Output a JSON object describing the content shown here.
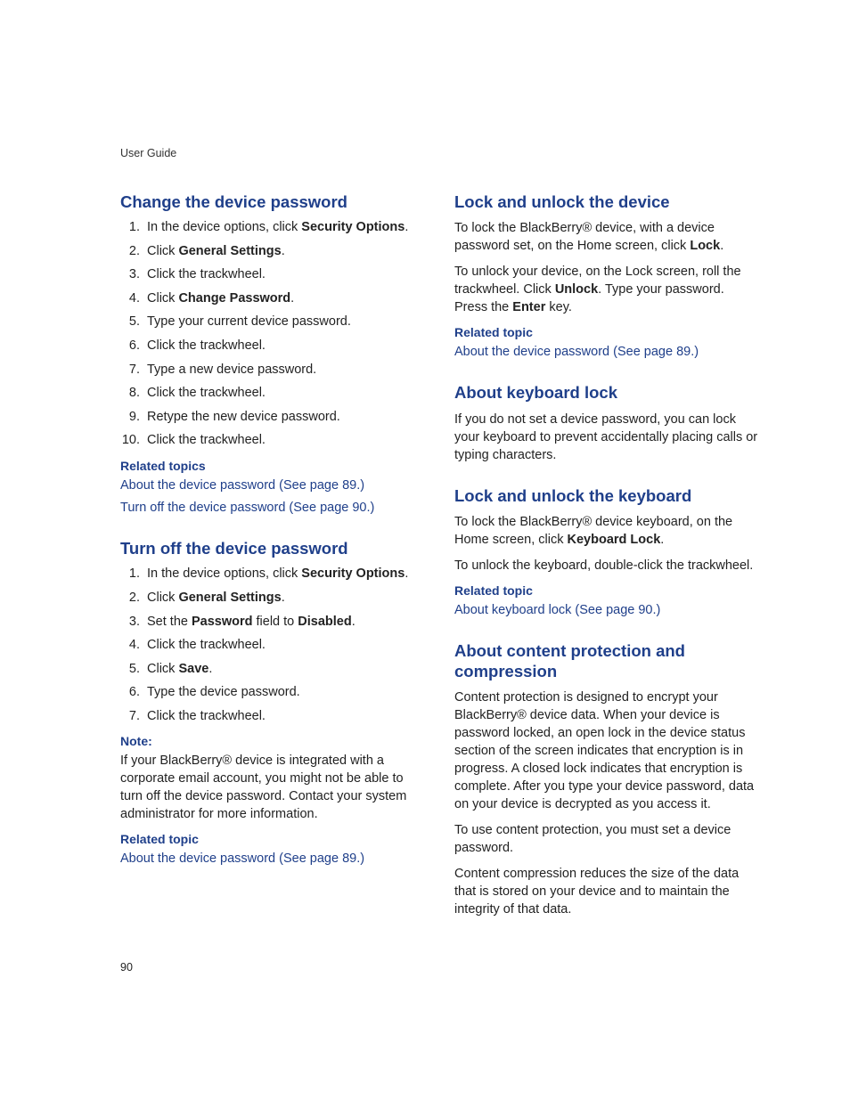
{
  "running_header": "User Guide",
  "page_number": "90",
  "left": {
    "s1": {
      "heading": "Change the device password",
      "steps": [
        [
          {
            "t": "In the device options, click "
          },
          {
            "t": "Security Options",
            "b": true
          },
          {
            "t": "."
          }
        ],
        [
          {
            "t": "Click "
          },
          {
            "t": "General Settings",
            "b": true
          },
          {
            "t": "."
          }
        ],
        [
          {
            "t": "Click the trackwheel."
          }
        ],
        [
          {
            "t": "Click "
          },
          {
            "t": "Change Password",
            "b": true
          },
          {
            "t": "."
          }
        ],
        [
          {
            "t": "Type your current device password."
          }
        ],
        [
          {
            "t": "Click the trackwheel."
          }
        ],
        [
          {
            "t": "Type a new device password."
          }
        ],
        [
          {
            "t": "Click the trackwheel."
          }
        ],
        [
          {
            "t": "Retype the new device password."
          }
        ],
        [
          {
            "t": "Click the trackwheel."
          }
        ]
      ],
      "related_heading": "Related topics",
      "related_links": [
        "About the device password (See page 89.)",
        "Turn off the device password (See page 90.)"
      ]
    },
    "s2": {
      "heading": "Turn off the device password",
      "steps": [
        [
          {
            "t": "In the device options, click "
          },
          {
            "t": "Security Options",
            "b": true
          },
          {
            "t": "."
          }
        ],
        [
          {
            "t": "Click "
          },
          {
            "t": "General Settings",
            "b": true
          },
          {
            "t": "."
          }
        ],
        [
          {
            "t": "Set the "
          },
          {
            "t": "Password",
            "b": true
          },
          {
            "t": " field to "
          },
          {
            "t": "Disabled",
            "b": true
          },
          {
            "t": "."
          }
        ],
        [
          {
            "t": "Click the trackwheel."
          }
        ],
        [
          {
            "t": "Click "
          },
          {
            "t": "Save",
            "b": true
          },
          {
            "t": "."
          }
        ],
        [
          {
            "t": "Type the device password."
          }
        ],
        [
          {
            "t": "Click the trackwheel."
          }
        ]
      ],
      "note_heading": "Note:",
      "note_body": "If your BlackBerry® device is integrated with a corporate email account, you might not be able to turn off the device password. Contact your system administrator for more information.",
      "related_heading": "Related topic",
      "related_links": [
        "About the device password (See page 89.)"
      ]
    }
  },
  "right": {
    "s1": {
      "heading": "Lock and unlock the device",
      "paras": [
        [
          {
            "t": "To lock the BlackBerry® device, with a device password set, on the Home screen, click "
          },
          {
            "t": "Lock",
            "b": true
          },
          {
            "t": "."
          }
        ],
        [
          {
            "t": "To unlock your device, on the Lock screen, roll the trackwheel. Click "
          },
          {
            "t": "Unlock",
            "b": true
          },
          {
            "t": ". Type your password. Press the "
          },
          {
            "t": "Enter",
            "b": true
          },
          {
            "t": " key."
          }
        ]
      ],
      "related_heading": "Related topic",
      "related_links": [
        "About the device password (See page 89.)"
      ]
    },
    "s2": {
      "heading": "About keyboard lock",
      "paras": [
        [
          {
            "t": "If you do not set a device password, you can lock your keyboard to prevent accidentally placing calls or typing characters."
          }
        ]
      ]
    },
    "s3": {
      "heading": "Lock and unlock the keyboard",
      "paras": [
        [
          {
            "t": "To lock the BlackBerry® device keyboard, on the Home screen, click "
          },
          {
            "t": "Keyboard Lock",
            "b": true
          },
          {
            "t": "."
          }
        ],
        [
          {
            "t": "To unlock the keyboard, double-click the trackwheel."
          }
        ]
      ],
      "related_heading": "Related topic",
      "related_links": [
        "About keyboard lock (See page 90.)"
      ]
    },
    "s4": {
      "heading": "About content protection and compression",
      "paras": [
        [
          {
            "t": "Content protection is designed to encrypt your BlackBerry® device data. When your device is password locked, an open lock in the device status section of the screen indicates that encryption is in progress. A closed lock indicates that encryption is complete. After you type your device password, data on your device is decrypted as you access it."
          }
        ],
        [
          {
            "t": "To use content protection, you must set a device password."
          }
        ],
        [
          {
            "t": "Content compression reduces the size of the data that is stored on your device and to maintain the integrity of that data."
          }
        ]
      ]
    }
  }
}
